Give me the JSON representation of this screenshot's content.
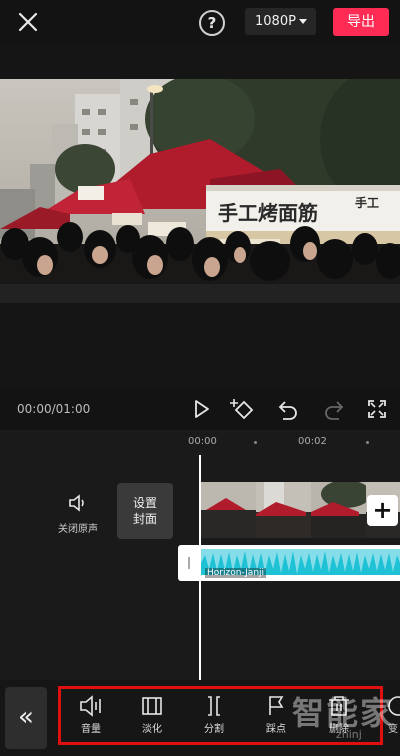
{
  "topbar": {
    "help_symbol": "?",
    "resolution": "1080P",
    "export_label": "导出"
  },
  "video": {
    "sign_text": "手工烤面筋",
    "sign_text_right": "手工"
  },
  "playback": {
    "time": "00:00/01:00"
  },
  "timeline": {
    "ruler": [
      "00:00",
      "00:02"
    ],
    "mute_label": "关闭原声",
    "cover_label_line1": "设置",
    "cover_label_line2": "封面",
    "add_symbol": "+",
    "audio_name": "Horizon-Janji"
  },
  "toolbar": {
    "collapse_symbol": "«",
    "items": [
      {
        "label": "音量",
        "icon": "volume-icon"
      },
      {
        "label": "淡化",
        "icon": "fade-icon"
      },
      {
        "label": "分割",
        "icon": "split-icon"
      },
      {
        "label": "踩点",
        "icon": "beat-flag-icon"
      },
      {
        "label": "删除",
        "icon": "delete-icon"
      },
      {
        "label": "变",
        "icon": "speed-icon"
      }
    ]
  },
  "watermark": {
    "text": "智能家",
    "url": "zhinj"
  },
  "colors": {
    "accent": "#fe2c55",
    "audio_wave": "#1fc1d6",
    "highlight_border": "#e01010"
  }
}
